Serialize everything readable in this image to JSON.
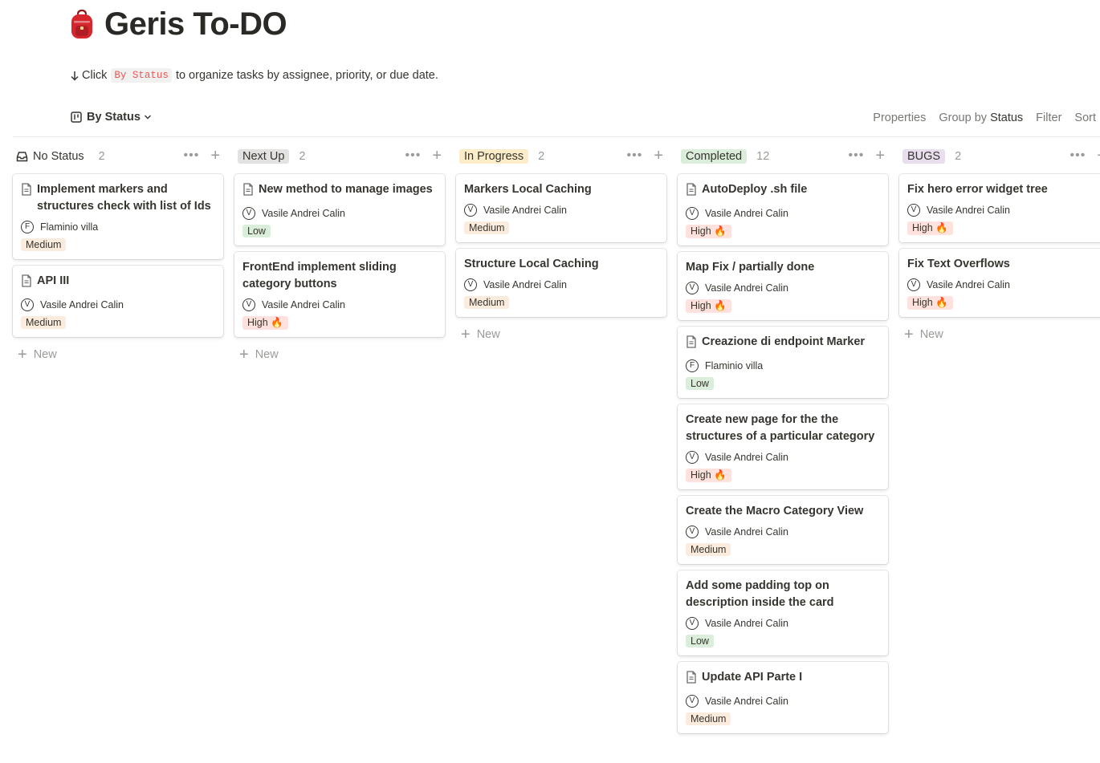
{
  "page": {
    "icon": "backpack-icon",
    "title": "Geris To-DO",
    "hint_prefix": "Click",
    "hint_code": "By Status",
    "hint_suffix": "to organize tasks by assignee, priority, or due date."
  },
  "view": {
    "name": "By Status",
    "board_icon": "board-icon",
    "properties": "Properties",
    "group_by_label": "Group by",
    "group_by_value": "Status",
    "filter": "Filter",
    "sort": "Sort"
  },
  "colors": {
    "low": "#dbeddb",
    "medium": "#fbecdd",
    "high": "#ffe2dd",
    "no_status": "transparent",
    "next_up": "#e3e2e0",
    "in_progress": "#fdecc8",
    "completed": "#dbeddb",
    "bugs": "#e8deee"
  },
  "new_label": "New",
  "columns": [
    {
      "name": "No Status",
      "count": "2",
      "cards": [
        {
          "title": "Implement markers and structures check with list of Ids",
          "has_doc": true,
          "initial": "F",
          "assignee": "Flaminio villa",
          "priority": "Medium"
        },
        {
          "title": "API III",
          "has_doc": true,
          "initial": "V",
          "assignee": "Vasile Andrei Calin",
          "priority": "Medium"
        }
      ]
    },
    {
      "name": "Next Up",
      "count": "2",
      "cards": [
        {
          "title": "New method to manage images",
          "has_doc": true,
          "initial": "V",
          "assignee": "Vasile Andrei Calin",
          "priority": "Low"
        },
        {
          "title": "FrontEnd implement sliding category buttons",
          "has_doc": false,
          "initial": "V",
          "assignee": "Vasile Andrei Calin",
          "priority": "High 🔥"
        }
      ]
    },
    {
      "name": "In Progress",
      "count": "2",
      "cards": [
        {
          "title": "Markers Local Caching",
          "has_doc": false,
          "initial": "V",
          "assignee": "Vasile Andrei Calin",
          "priority": "Medium"
        },
        {
          "title": "Structure Local Caching",
          "has_doc": false,
          "initial": "V",
          "assignee": "Vasile Andrei Calin",
          "priority": "Medium"
        }
      ]
    },
    {
      "name": "Completed",
      "count": "12",
      "cards": [
        {
          "title": "AutoDeploy .sh file",
          "has_doc": true,
          "initial": "V",
          "assignee": "Vasile Andrei Calin",
          "priority": "High 🔥"
        },
        {
          "title": "Map Fix / partially done",
          "has_doc": false,
          "initial": "V",
          "assignee": "Vasile Andrei Calin",
          "priority": "High 🔥"
        },
        {
          "title": "Creazione di endpoint Marker",
          "has_doc": true,
          "initial": "F",
          "assignee": "Flaminio villa",
          "priority": "Low"
        },
        {
          "title": "Create new page for the the structures of a particular category",
          "has_doc": false,
          "initial": "V",
          "assignee": "Vasile Andrei Calin",
          "priority": "High 🔥"
        },
        {
          "title": "Create the Macro Category View",
          "has_doc": false,
          "initial": "V",
          "assignee": "Vasile Andrei Calin",
          "priority": "Medium"
        },
        {
          "title": "Add some padding top on description inside the card",
          "has_doc": false,
          "initial": "V",
          "assignee": "Vasile Andrei Calin",
          "priority": "Low"
        },
        {
          "title": "Update API Parte I",
          "has_doc": true,
          "initial": "V",
          "assignee": "Vasile Andrei Calin",
          "priority": "Medium"
        }
      ]
    },
    {
      "name": "BUGS",
      "count": "2",
      "cards": [
        {
          "title": "Fix hero error widget tree",
          "has_doc": false,
          "initial": "V",
          "assignee": "Vasile Andrei Calin",
          "priority": "High 🔥"
        },
        {
          "title": "Fix Text Overflows",
          "has_doc": false,
          "initial": "V",
          "assignee": "Vasile Andrei Calin",
          "priority": "High 🔥"
        }
      ]
    }
  ]
}
